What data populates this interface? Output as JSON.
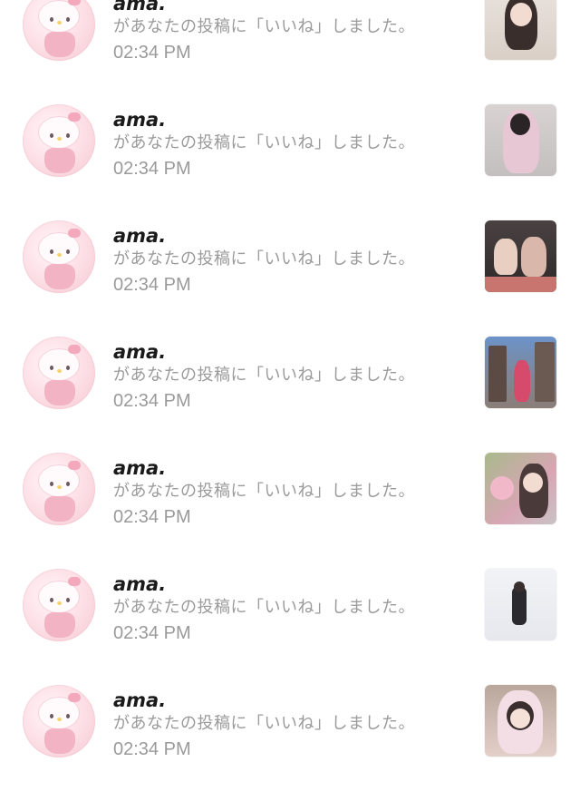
{
  "notifications": [
    {
      "name": "ama.",
      "message": "があなたの投稿に「いいね」しました。",
      "time": "02:34 PM"
    },
    {
      "name": "ama.",
      "message": "があなたの投稿に「いいね」しました。",
      "time": "02:34 PM"
    },
    {
      "name": "ama.",
      "message": "があなたの投稿に「いいね」しました。",
      "time": "02:34 PM"
    },
    {
      "name": "ama.",
      "message": "があなたの投稿に「いいね」しました。",
      "time": "02:34 PM"
    },
    {
      "name": "ama.",
      "message": "があなたの投稿に「いいね」しました。",
      "time": "02:34 PM"
    },
    {
      "name": "ama.",
      "message": "があなたの投稿に「いいね」しました。",
      "time": "02:34 PM"
    },
    {
      "name": "ama.",
      "message": "があなたの投稿に「いいね」しました。",
      "time": "02:34 PM"
    }
  ],
  "colors": {
    "name_text": "#1a1a1a",
    "secondary_text": "#9a9a9a",
    "avatar_pink": "#f7c9d3"
  },
  "icons": {
    "avatar": "hello-kitty-avatar-icon"
  }
}
